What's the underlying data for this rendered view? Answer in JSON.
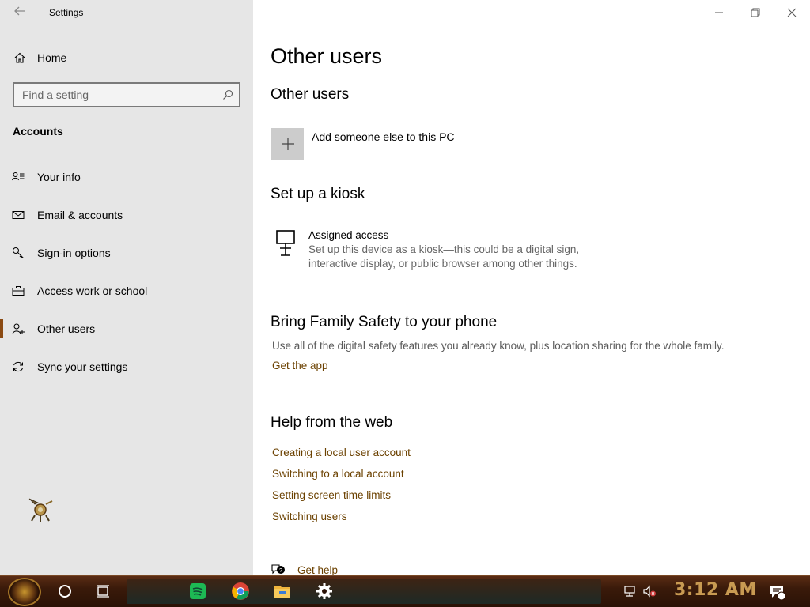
{
  "window": {
    "title": "Settings"
  },
  "sidebar": {
    "home_label": "Home",
    "search_placeholder": "Find a setting",
    "section_label": "Accounts",
    "items": [
      {
        "label": "Your info",
        "icon": "person-card-icon"
      },
      {
        "label": "Email & accounts",
        "icon": "mail-icon"
      },
      {
        "label": "Sign-in options",
        "icon": "key-icon"
      },
      {
        "label": "Access work or school",
        "icon": "briefcase-icon"
      },
      {
        "label": "Other users",
        "icon": "add-person-icon",
        "active": true
      },
      {
        "label": "Sync your settings",
        "icon": "sync-icon"
      }
    ]
  },
  "main": {
    "page_title": "Other users",
    "other_users_heading": "Other users",
    "add_user_label": "Add someone else to this PC",
    "kiosk_heading": "Set up a kiosk",
    "kiosk_title": "Assigned access",
    "kiosk_description": "Set up this device as a kiosk—this could be a digital sign, interactive display, or public browser among other things.",
    "family_heading": "Bring Family Safety to your phone",
    "family_text": "Use all of the digital safety features you already know, plus location sharing for the whole family.",
    "family_link": "Get the app",
    "help_heading": "Help from the web",
    "help_links": [
      "Creating a local user account",
      "Switching to a local account",
      "Setting screen time limits",
      "Switching users"
    ],
    "get_help_label": "Get help"
  },
  "taskbar": {
    "clock": "3:12 AM",
    "apps": [
      "spotify-icon",
      "chrome-icon",
      "file-explorer-icon",
      "settings-gear-icon"
    ],
    "notification_count": "1"
  },
  "colors": {
    "sidebar_bg": "#e6e6e6",
    "accent": "#8b4a12",
    "link": "#6b4100",
    "clock": "#c89a52"
  }
}
